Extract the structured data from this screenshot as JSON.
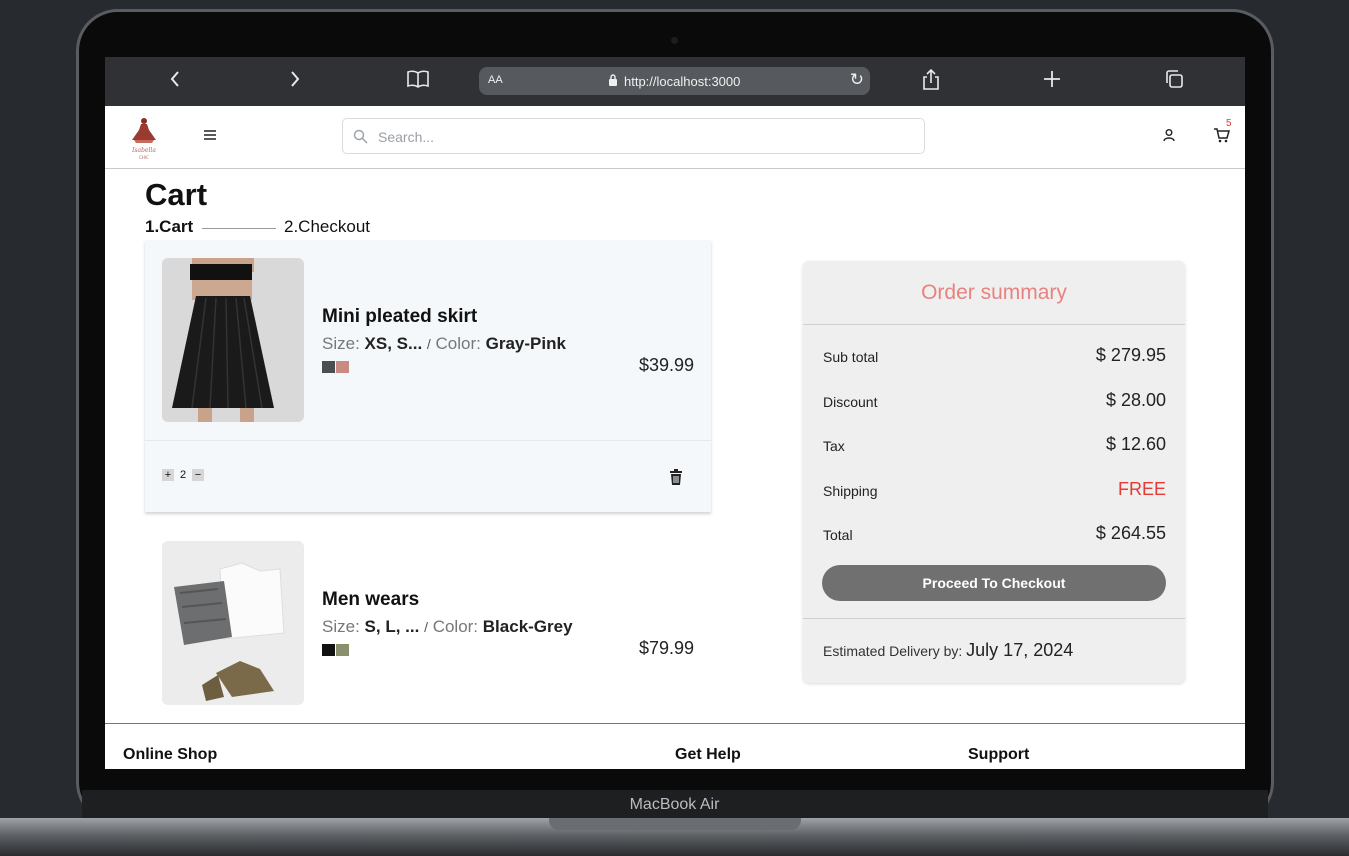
{
  "device": {
    "brand": "MacBook Air"
  },
  "browser": {
    "aa_label": "AA",
    "url": "http://localhost:3000"
  },
  "header": {
    "search_placeholder": "Search...",
    "cart_count": "5",
    "logo_alt": "Isabella Chic"
  },
  "page": {
    "title": "Cart",
    "steps": [
      {
        "label": "1.Cart",
        "active": true
      },
      {
        "label": "2.Checkout",
        "active": false
      }
    ]
  },
  "cart": {
    "items": [
      {
        "name": "Mini pleated skirt",
        "size_label": "Size:",
        "size": "XS, S...",
        "color_sep": "/",
        "color_label": "Color:",
        "color": "Gray-Pink",
        "swatches": [
          "#4a4d52",
          "#c98a84"
        ],
        "price": "$39.99",
        "quantity": "2"
      },
      {
        "name": "Men wears",
        "size_label": "Size:",
        "size": "S, L, ...",
        "color_sep": "/",
        "color_label": "Color:",
        "color": "Black-Grey",
        "swatches": [
          "#111111",
          "#8a8f6e"
        ],
        "price": "$79.99"
      }
    ]
  },
  "summary": {
    "title": "Order summary",
    "rows": [
      {
        "label": "Sub total",
        "value": "$ 279.95"
      },
      {
        "label": "Discount",
        "value": "$ 28.00"
      },
      {
        "label": "Tax",
        "value": "$ 12.60"
      },
      {
        "label": "Shipping",
        "value": "FREE"
      },
      {
        "label": "Total",
        "value": "$ 264.55"
      }
    ],
    "checkout_label": "Proceed To Checkout",
    "delivery_label": "Estimated Delivery by:",
    "delivery_date": "July 17, 2024"
  },
  "footer": {
    "columns": [
      "Online Shop",
      "Get Help",
      "Support"
    ]
  },
  "colors": {
    "accent_title": "#e8827f",
    "free": "#e53935",
    "button": "#707070"
  }
}
